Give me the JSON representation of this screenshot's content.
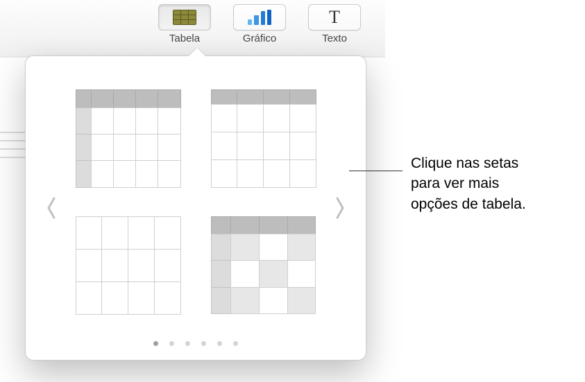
{
  "toolbar": {
    "table_label": "Tabela",
    "chart_label": "Gráfico",
    "text_label": "Texto",
    "text_glyph": "T"
  },
  "callout": {
    "line1": "Clique nas setas",
    "line2": "para ver mais",
    "line3": "opções de tabela."
  },
  "pager": {
    "dot_count": 6,
    "active_index": 0
  }
}
